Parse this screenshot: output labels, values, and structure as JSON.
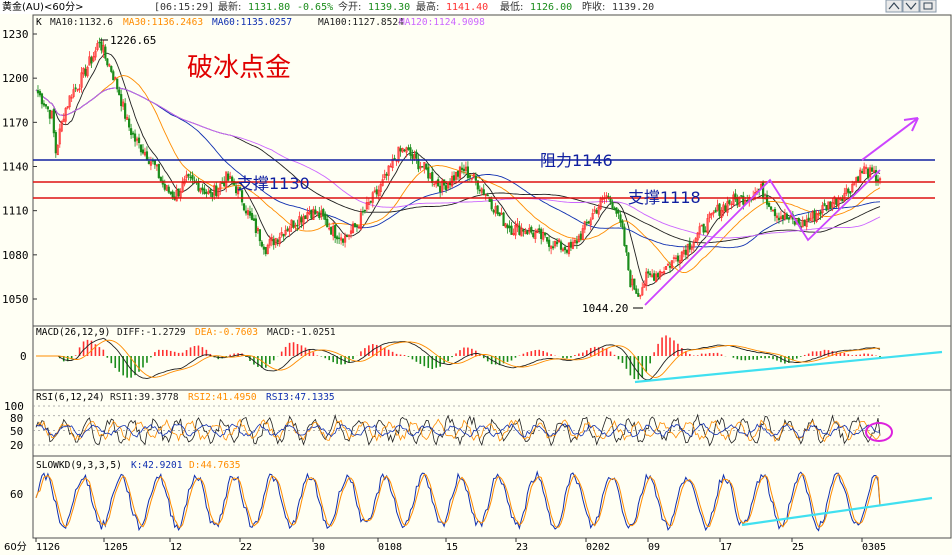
{
  "top": {
    "instrument": "黄金(AU)<60分>",
    "time": "[06:15:29]",
    "latest_label": "最新:",
    "latest": "1131.80",
    "change": "-0.65%",
    "open_label": "今开:",
    "open": "1139.30",
    "high_label": "最高:",
    "high": "1141.40",
    "low_label": "最低:",
    "low": "1126.00",
    "prev_label": "昨收:",
    "prev": "1139.20"
  },
  "window_buttons": [
    "up",
    "down",
    "restore"
  ],
  "colors": {
    "bg": "#fffff4",
    "frame": "#4f4f4f",
    "up": "#ff3030",
    "down": "#1a8c1a",
    "ma10": "#202020",
    "ma30": "#ff8c00",
    "ma60": "#1030b0",
    "ma100": "#202020",
    "ma120": "#cc66ff",
    "support": "#dd1010",
    "resistance": "#1020a0",
    "arrow": "#cc44ff",
    "trend": "#40e0f0",
    "title": "#e00000"
  },
  "main_legend": {
    "k": "K",
    "items": [
      {
        "text": "MA10:1132.6",
        "color": "#202020"
      },
      {
        "text": "MA30:1136.2463",
        "color": "#ff8c00"
      },
      {
        "text": "MA60:1135.0257",
        "color": "#1030b0"
      },
      {
        "text": "MA100:1127.8524",
        "color": "#202020"
      },
      {
        "text": "MA120:1124.9098",
        "color": "#cc66ff"
      }
    ]
  },
  "annotations": {
    "title": "破冰点金",
    "support1130": "支撑1130",
    "resistance1146": "阻力1146",
    "support1118": "支撑1118",
    "high_mark": "1226.65",
    "low_mark": "1044.20"
  },
  "macd_legend": {
    "name": "MACD(26,12,9)",
    "diff": "DIFF:-1.2729",
    "dea": "DEA:-0.7603",
    "macd": "MACD:-1.0251"
  },
  "rsi_legend": {
    "name": "RSI(6,12,24)",
    "rsi1": "RSI1:39.3778",
    "rsi2": "RSI2:41.4950",
    "rsi3": "RSI3:47.1335"
  },
  "kd_legend": {
    "name": "SLOWKD(9,3,3,5)",
    "k": "K:42.9201",
    "d": "D:44.7635"
  },
  "x_axis_label": "60分",
  "chart_data": [
    {
      "type": "candlestick",
      "panel": "price",
      "y_ticks": [
        1230,
        1200,
        1170,
        1140,
        1110,
        1080,
        1050
      ],
      "ylim": [
        1040,
        1236
      ],
      "x_ticks": [
        "1126",
        "1205",
        "12",
        "22",
        "30",
        "0108",
        "15",
        "23",
        "0202",
        "09",
        "17",
        "25",
        "0305"
      ],
      "path_anchors": [
        [
          0,
          1192
        ],
        [
          4,
          1184
        ],
        [
          8,
          1174
        ],
        [
          10,
          1150
        ],
        [
          14,
          1176
        ],
        [
          18,
          1190
        ],
        [
          22,
          1197
        ],
        [
          26,
          1208
        ],
        [
          30,
          1218
        ],
        [
          32,
          1226
        ],
        [
          35,
          1214
        ],
        [
          38,
          1206
        ],
        [
          42,
          1190
        ],
        [
          46,
          1170
        ],
        [
          50,
          1158
        ],
        [
          55,
          1150
        ],
        [
          60,
          1140
        ],
        [
          65,
          1125
        ],
        [
          70,
          1120
        ],
        [
          76,
          1130
        ],
        [
          82,
          1128
        ],
        [
          88,
          1120
        ],
        [
          92,
          1126
        ],
        [
          96,
          1132
        ],
        [
          100,
          1128
        ],
        [
          104,
          1118
        ],
        [
          108,
          1105
        ],
        [
          112,
          1095
        ],
        [
          116,
          1085
        ],
        [
          120,
          1090
        ],
        [
          126,
          1098
        ],
        [
          132,
          1104
        ],
        [
          138,
          1110
        ],
        [
          144,
          1106
        ],
        [
          150,
          1096
        ],
        [
          156,
          1092
        ],
        [
          162,
          1100
        ],
        [
          166,
          1110
        ],
        [
          170,
          1118
        ],
        [
          174,
          1126
        ],
        [
          178,
          1136
        ],
        [
          182,
          1148
        ],
        [
          186,
          1152
        ],
        [
          190,
          1146
        ],
        [
          195,
          1140
        ],
        [
          200,
          1132
        ],
        [
          205,
          1126
        ],
        [
          210,
          1132
        ],
        [
          216,
          1138
        ],
        [
          222,
          1130
        ],
        [
          228,
          1120
        ],
        [
          234,
          1106
        ],
        [
          240,
          1098
        ],
        [
          246,
          1098
        ],
        [
          252,
          1094
        ],
        [
          258,
          1090
        ],
        [
          264,
          1086
        ],
        [
          270,
          1084
        ],
        [
          276,
          1096
        ],
        [
          282,
          1110
        ],
        [
          288,
          1120
        ],
        [
          292,
          1114
        ],
        [
          296,
          1095
        ],
        [
          300,
          1062
        ],
        [
          304,
          1054
        ],
        [
          308,
          1064
        ],
        [
          314,
          1068
        ],
        [
          320,
          1074
        ],
        [
          326,
          1082
        ],
        [
          332,
          1090
        ],
        [
          338,
          1100
        ],
        [
          344,
          1110
        ],
        [
          350,
          1116
        ],
        [
          356,
          1118
        ],
        [
          362,
          1122
        ],
        [
          366,
          1124
        ],
        [
          370,
          1116
        ],
        [
          374,
          1108
        ],
        [
          380,
          1104
        ],
        [
          386,
          1100
        ],
        [
          392,
          1106
        ],
        [
          398,
          1112
        ],
        [
          404,
          1118
        ],
        [
          410,
          1124
        ],
        [
          414,
          1132
        ],
        [
          418,
          1138
        ],
        [
          422,
          1134
        ],
        [
          426,
          1131
        ]
      ],
      "last_close": 1131.8,
      "ma_series": [
        "MA10",
        "MA30",
        "MA60",
        "MA100",
        "MA120"
      ]
    },
    {
      "type": "bar+line",
      "panel": "MACD",
      "y_ticks": [
        0
      ],
      "series": [
        "DIFF",
        "DEA",
        "MACD"
      ],
      "last": {
        "DIFF": -1.2729,
        "DEA": -0.7603,
        "MACD": -1.0251
      }
    },
    {
      "type": "line",
      "panel": "RSI",
      "y_ticks": [
        100,
        80,
        50,
        20
      ],
      "ylim": [
        0,
        100
      ],
      "series": [
        "RSI1",
        "RSI2",
        "RSI3"
      ],
      "last": {
        "RSI1": 39.3778,
        "RSI2": 41.495,
        "RSI3": 47.1335
      }
    },
    {
      "type": "line",
      "panel": "SLOWKD",
      "y_ticks": [
        60
      ],
      "ylim": [
        0,
        100
      ],
      "series": [
        "K",
        "D"
      ],
      "last": {
        "K": 42.9201,
        "D": 44.7635
      }
    }
  ]
}
